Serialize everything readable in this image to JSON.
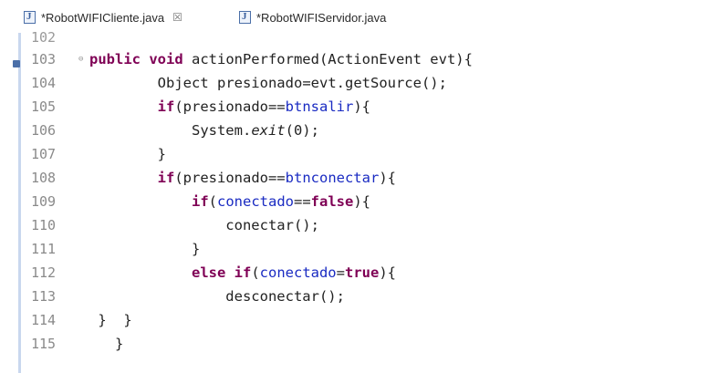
{
  "tabs": [
    {
      "label": "*RobotWIFICliente.java",
      "close": "☒"
    },
    {
      "label": "*RobotWIFIServidor.java"
    }
  ],
  "editor": {
    "partial_line_number": "102",
    "lines": [
      {
        "num": "103",
        "tokens": [
          {
            "t": "public void",
            "c": "kw"
          },
          {
            "t": " actionPerformed(ActionEvent ",
            "c": ""
          },
          {
            "t": "evt",
            "c": ""
          },
          {
            "t": "){",
            "c": ""
          }
        ]
      },
      {
        "num": "104",
        "tokens": [
          {
            "t": "        Object ",
            "c": ""
          },
          {
            "t": "presionado",
            "c": ""
          },
          {
            "t": "=",
            "c": ""
          },
          {
            "t": "evt",
            "c": ""
          },
          {
            "t": ".getSource();",
            "c": ""
          }
        ]
      },
      {
        "num": "105",
        "tokens": [
          {
            "t": "        ",
            "c": ""
          },
          {
            "t": "if",
            "c": "kw"
          },
          {
            "t": "(presionado==",
            "c": ""
          },
          {
            "t": "btnsalir",
            "c": "fld"
          },
          {
            "t": "){",
            "c": ""
          }
        ]
      },
      {
        "num": "106",
        "tokens": [
          {
            "t": "            System.",
            "c": ""
          },
          {
            "t": "exit",
            "c": "it"
          },
          {
            "t": "(0);",
            "c": ""
          }
        ]
      },
      {
        "num": "107",
        "tokens": [
          {
            "t": "        }",
            "c": ""
          }
        ]
      },
      {
        "num": "108",
        "tokens": [
          {
            "t": "        ",
            "c": ""
          },
          {
            "t": "if",
            "c": "kw"
          },
          {
            "t": "(presionado==",
            "c": ""
          },
          {
            "t": "btnconectar",
            "c": "fld"
          },
          {
            "t": "){",
            "c": ""
          }
        ]
      },
      {
        "num": "109",
        "tokens": [
          {
            "t": "            ",
            "c": ""
          },
          {
            "t": "if",
            "c": "kw"
          },
          {
            "t": "(",
            "c": ""
          },
          {
            "t": "conectado",
            "c": "fld"
          },
          {
            "t": "==",
            "c": ""
          },
          {
            "t": "false",
            "c": "kw"
          },
          {
            "t": "){",
            "c": ""
          }
        ]
      },
      {
        "num": "110",
        "tokens": [
          {
            "t": "                conectar();",
            "c": ""
          }
        ]
      },
      {
        "num": "111",
        "tokens": [
          {
            "t": "            }",
            "c": ""
          }
        ]
      },
      {
        "num": "112",
        "tokens": [
          {
            "t": "            ",
            "c": ""
          },
          {
            "t": "else if",
            "c": "kw"
          },
          {
            "t": "(",
            "c": ""
          },
          {
            "t": "conectado",
            "c": "fld"
          },
          {
            "t": "=",
            "c": ""
          },
          {
            "t": "true",
            "c": "kw"
          },
          {
            "t": "){",
            "c": ""
          }
        ]
      },
      {
        "num": "113",
        "tokens": [
          {
            "t": "                desconectar();",
            "c": ""
          }
        ]
      },
      {
        "num": "114",
        "tokens": [
          {
            "t": " }  }",
            "c": ""
          }
        ]
      },
      {
        "num": "115",
        "tokens": [
          {
            "t": "   }",
            "c": ""
          }
        ]
      }
    ]
  }
}
